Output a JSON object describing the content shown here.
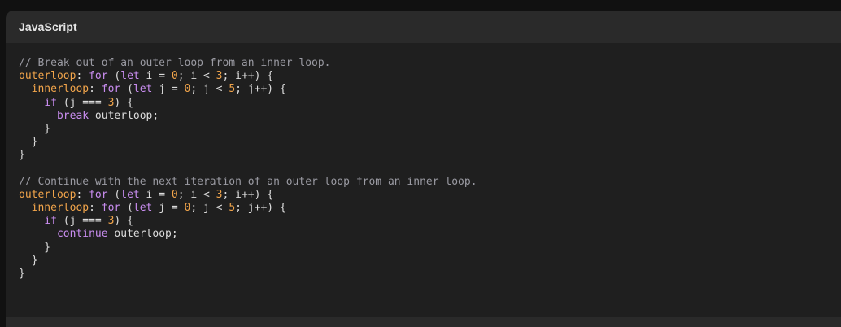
{
  "code_panel": {
    "language": "JavaScript",
    "lines": [
      [
        {
          "t": "// Break out of an outer loop from an inner loop.",
          "k": "comment"
        }
      ],
      [
        {
          "t": "outerloop",
          "k": "label"
        },
        {
          "t": ": ",
          "k": "default"
        },
        {
          "t": "for",
          "k": "keyword"
        },
        {
          "t": " (",
          "k": "default"
        },
        {
          "t": "let",
          "k": "keyword"
        },
        {
          "t": " i = ",
          "k": "default"
        },
        {
          "t": "0",
          "k": "number"
        },
        {
          "t": "; i < ",
          "k": "default"
        },
        {
          "t": "3",
          "k": "number"
        },
        {
          "t": "; i++) {",
          "k": "default"
        }
      ],
      [
        {
          "t": "  ",
          "k": "default"
        },
        {
          "t": "innerloop",
          "k": "label"
        },
        {
          "t": ": ",
          "k": "default"
        },
        {
          "t": "for",
          "k": "keyword"
        },
        {
          "t": " (",
          "k": "default"
        },
        {
          "t": "let",
          "k": "keyword"
        },
        {
          "t": " j = ",
          "k": "default"
        },
        {
          "t": "0",
          "k": "number"
        },
        {
          "t": "; j < ",
          "k": "default"
        },
        {
          "t": "5",
          "k": "number"
        },
        {
          "t": "; j++) {",
          "k": "default"
        }
      ],
      [
        {
          "t": "    ",
          "k": "default"
        },
        {
          "t": "if",
          "k": "keyword"
        },
        {
          "t": " (j === ",
          "k": "default"
        },
        {
          "t": "3",
          "k": "number"
        },
        {
          "t": ") {",
          "k": "default"
        }
      ],
      [
        {
          "t": "      ",
          "k": "default"
        },
        {
          "t": "break",
          "k": "keyword"
        },
        {
          "t": " outerloop;",
          "k": "default"
        }
      ],
      [
        {
          "t": "    }",
          "k": "default"
        }
      ],
      [
        {
          "t": "  }",
          "k": "default"
        }
      ],
      [
        {
          "t": "}",
          "k": "default"
        }
      ],
      [
        {
          "t": "",
          "k": "default"
        }
      ],
      [
        {
          "t": "// Continue with the next iteration of an outer loop from an inner loop.",
          "k": "comment"
        }
      ],
      [
        {
          "t": "outerloop",
          "k": "label"
        },
        {
          "t": ": ",
          "k": "default"
        },
        {
          "t": "for",
          "k": "keyword"
        },
        {
          "t": " (",
          "k": "default"
        },
        {
          "t": "let",
          "k": "keyword"
        },
        {
          "t": " i = ",
          "k": "default"
        },
        {
          "t": "0",
          "k": "number"
        },
        {
          "t": "; i < ",
          "k": "default"
        },
        {
          "t": "3",
          "k": "number"
        },
        {
          "t": "; i++) {",
          "k": "default"
        }
      ],
      [
        {
          "t": "  ",
          "k": "default"
        },
        {
          "t": "innerloop",
          "k": "label"
        },
        {
          "t": ": ",
          "k": "default"
        },
        {
          "t": "for",
          "k": "keyword"
        },
        {
          "t": " (",
          "k": "default"
        },
        {
          "t": "let",
          "k": "keyword"
        },
        {
          "t": " j = ",
          "k": "default"
        },
        {
          "t": "0",
          "k": "number"
        },
        {
          "t": "; j < ",
          "k": "default"
        },
        {
          "t": "5",
          "k": "number"
        },
        {
          "t": "; j++) {",
          "k": "default"
        }
      ],
      [
        {
          "t": "    ",
          "k": "default"
        },
        {
          "t": "if",
          "k": "keyword"
        },
        {
          "t": " (j === ",
          "k": "default"
        },
        {
          "t": "3",
          "k": "number"
        },
        {
          "t": ") {",
          "k": "default"
        }
      ],
      [
        {
          "t": "      ",
          "k": "default"
        },
        {
          "t": "continue",
          "k": "keyword"
        },
        {
          "t": " outerloop;",
          "k": "default"
        }
      ],
      [
        {
          "t": "    }",
          "k": "default"
        }
      ],
      [
        {
          "t": "  }",
          "k": "default"
        }
      ],
      [
        {
          "t": "}",
          "k": "default"
        }
      ]
    ]
  },
  "colors": {
    "page_background": "#111111",
    "panel_background": "#1f1f1f",
    "header_background": "#2a2a2a",
    "comment": "#9a9aa2",
    "label": "#f2a54b",
    "keyword": "#c98df0",
    "number": "#f2a54b",
    "default": "#dcdcdc"
  }
}
